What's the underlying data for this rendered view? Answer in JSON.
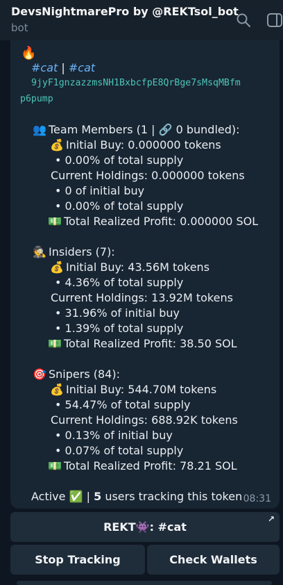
{
  "header": {
    "title": "DevsNightmarePro by @REKTsol_bot",
    "subtitle": "bot"
  },
  "message": {
    "fire_emoji": "🔥",
    "hashtag_1": "#cat",
    "separator": "|",
    "hashtag_2": "#cat",
    "address_line1": "9jyF1gnzazzmsNH1BxbcfpE8QrBge7sMsqMBfm",
    "address_line2": "p6pump",
    "team": {
      "emoji": "👥",
      "heading": "Team Members (1 | 🔗 0 bundled):",
      "bag": "💰",
      "initial_buy": "Initial Buy: 0.000000 tokens",
      "supply_pct": "• 0.00% of total supply",
      "holdings": "Current Holdings: 0.000000 tokens",
      "of_initial": "• 0 of initial buy",
      "holdings_supply_pct": "• 0.00% of total supply",
      "money": "💵",
      "profit": "Total Realized Profit: 0.000000 SOL"
    },
    "insiders": {
      "emoji": "🕵",
      "heading": "Insiders (7):",
      "bag": "💰",
      "initial_buy": "Initial Buy: 43.56M tokens",
      "supply_pct": "• 4.36% of total supply",
      "holdings": "Current Holdings: 13.92M tokens",
      "of_initial": "• 31.96% of initial buy",
      "holdings_supply_pct": "• 1.39% of total supply",
      "money": "💵",
      "profit": "Total Realized Profit: 38.50 SOL"
    },
    "snipers": {
      "emoji": "🎯",
      "heading": "Snipers (84):",
      "bag": "💰",
      "initial_buy": "Initial Buy: 544.70M tokens",
      "supply_pct": "• 54.47% of total supply",
      "holdings": "Current Holdings: 688.92K tokens",
      "of_initial": "• 0.13% of initial buy",
      "holdings_supply_pct": "• 0.07% of total supply",
      "money": "💵",
      "profit": "Total Realized Profit: 78.21 SOL"
    },
    "footer": {
      "active": "Active",
      "check": "✅",
      "sep": "|",
      "count": "5",
      "tracking": "users tracking this token"
    },
    "time": "08:31"
  },
  "buttons": {
    "rekt_label": "REKT👾: #cat",
    "stop_label": "Stop Tracking",
    "check_label": "Check Wallets"
  },
  "colors": {
    "background": "#0e1621",
    "bubble": "#182533",
    "link": "#6ab3f3",
    "button": "#1f2c3a"
  }
}
